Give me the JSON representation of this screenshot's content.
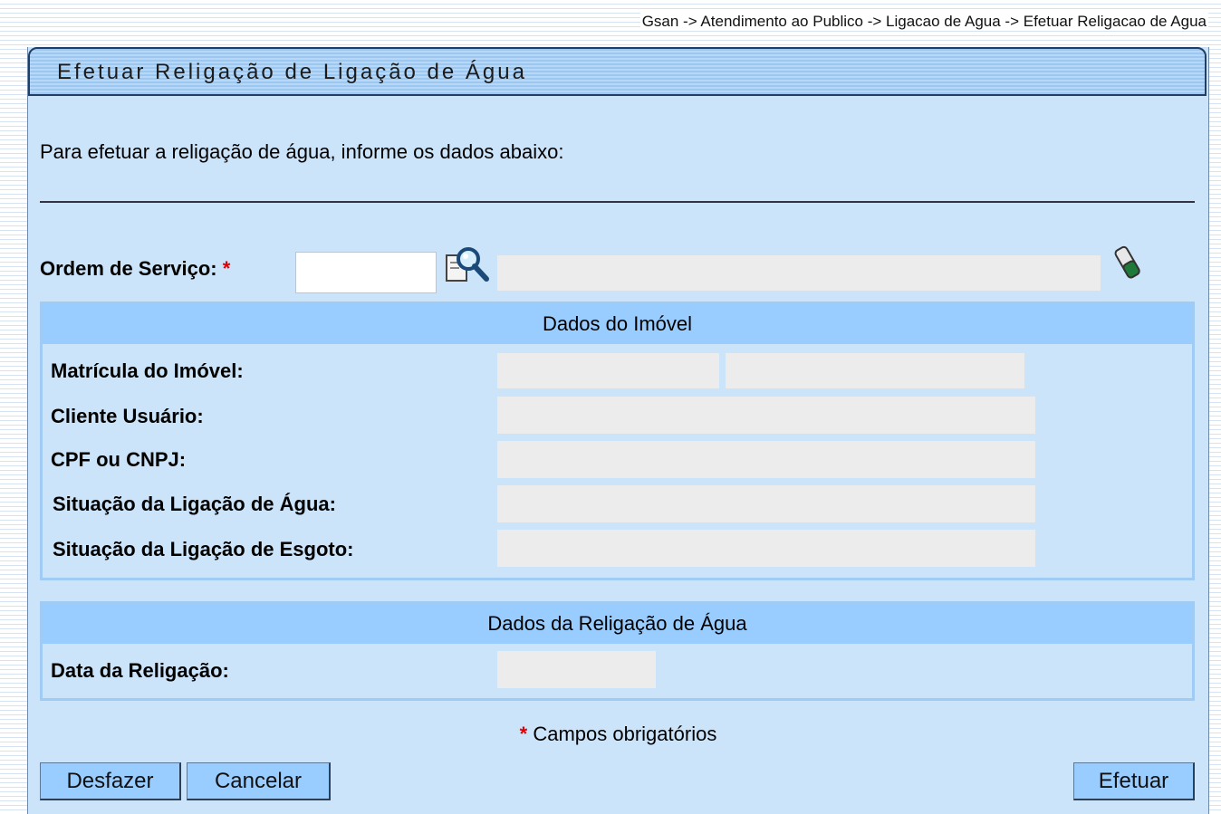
{
  "breadcrumb": "Gsan -> Atendimento ao Publico -> Ligacao de Agua -> Efetuar Religacao de Agua",
  "page": {
    "title": "Efetuar Religação de Ligação de Água",
    "intro": "Para efetuar a religação de água, informe os dados abaixo:"
  },
  "ordem": {
    "label": "Ordem de Serviço:",
    "required_mark": "*",
    "value": "",
    "description": ""
  },
  "imovel": {
    "header": "Dados do Imóvel",
    "matricula_label": "Matrícula do Imóvel:",
    "cliente_label": "Cliente Usuário:",
    "cpf_label": "CPF ou CNPJ:",
    "situacao_agua_label": "Situação da Ligação de Água:",
    "situacao_esgoto_label": "Situação da Ligação de Esgoto:"
  },
  "religacao": {
    "header": "Dados da Religação de Água",
    "data_label": "Data da Religação:"
  },
  "footer": {
    "required_mark": "*",
    "required_note": "Campos obrigatórios"
  },
  "buttons": {
    "desfazer": "Desfazer",
    "cancelar": "Cancelar",
    "efetuar": "Efetuar"
  },
  "icons": {
    "search": "magnifier-search-icon",
    "clear": "eraser-icon"
  }
}
